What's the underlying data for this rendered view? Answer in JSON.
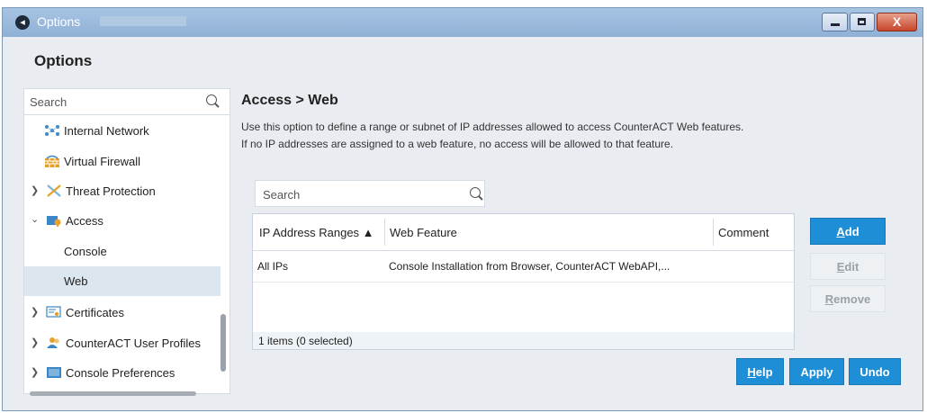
{
  "window": {
    "title": "Options",
    "buttons": {
      "minimize_icon": "minimize-icon",
      "maximize_icon": "maximize-icon",
      "close_label": "X"
    }
  },
  "page_title": "Options",
  "sidebar": {
    "search_placeholder": "Search",
    "items": [
      {
        "label": "Internal Network",
        "icon": "network-icon",
        "expandable": false
      },
      {
        "label": "Virtual Firewall",
        "icon": "firewall-icon",
        "expandable": false
      },
      {
        "label": "Threat Protection",
        "icon": "threat-icon",
        "expandable": true,
        "expanded": false
      },
      {
        "label": "Access",
        "icon": "access-icon",
        "expandable": true,
        "expanded": true
      },
      {
        "label": "Console",
        "expandable": false
      },
      {
        "label": "Web",
        "expandable": false,
        "selected": true
      },
      {
        "label": "Certificates",
        "icon": "certificate-icon",
        "expandable": true,
        "expanded": false
      },
      {
        "label": "CounterACT User Profiles",
        "icon": "user-profiles-icon",
        "expandable": true,
        "expanded": false
      },
      {
        "label": "Console Preferences",
        "icon": "console-icon",
        "expandable": true,
        "expanded": false
      }
    ]
  },
  "content": {
    "title": "Access > Web",
    "description_line1": "Use this option to define a range or subnet of IP addresses allowed to access CounterACT Web features.",
    "description_line2": "If no IP addresses are assigned to a web feature, no access will be allowed to that feature.",
    "search_placeholder": "Search",
    "table": {
      "columns": [
        "IP Address Ranges ▲",
        "Web Feature",
        "Comment"
      ],
      "sort_indicator": "ascending",
      "rows": [
        {
          "ip_range": "All IPs",
          "web_feature": "Console Installation from Browser, CounterACT WebAPI,...",
          "comment": ""
        }
      ],
      "footer": "1 items (0 selected)"
    },
    "side_buttons": {
      "add": {
        "prefix": "",
        "mnemonic": "A",
        "rest": "dd",
        "enabled": true
      },
      "edit": {
        "prefix": "",
        "mnemonic": "E",
        "rest": "dit",
        "enabled": false
      },
      "remove": {
        "prefix": "",
        "mnemonic": "R",
        "rest": "emove",
        "enabled": false
      }
    },
    "footer_buttons": {
      "help": {
        "mnemonic": "H",
        "rest": "elp"
      },
      "apply": "Apply",
      "undo": "Undo"
    }
  },
  "colors": {
    "titlebar": "#8fb0d6",
    "primary_button": "#1e8fd6",
    "selected_row": "#dce6ee",
    "window_bg": "#e9edf1"
  }
}
